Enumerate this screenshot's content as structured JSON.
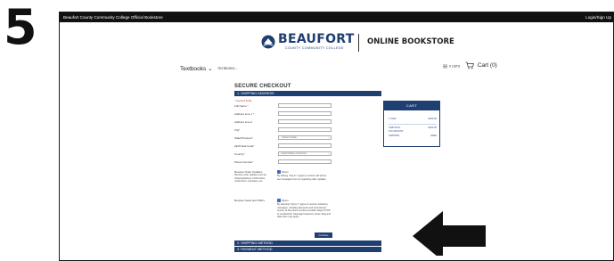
{
  "step": "5",
  "header": {
    "site_title": "Beaufort County Community College Official Bookstore",
    "login": "Login/Sign Up"
  },
  "brand": {
    "name": "BEAUFORT",
    "subtitle": "COUNTY COMMUNITY COLLEGE",
    "store": "ONLINE BOOKSTORE"
  },
  "nav": {
    "textbooks": "Textbooks",
    "textbooks_small": "TEXTBOOKS",
    "wishlist": "0 LISTS",
    "cart": "Cart (0)"
  },
  "checkout": {
    "title": "SECURE CHECKOUT",
    "section1": "1. SHIPPING ADDRESS",
    "required_note": "* required fields",
    "fields": [
      {
        "label": "Full Name *",
        "value": ""
      },
      {
        "label": "Address Line 1 *",
        "value": ""
      },
      {
        "label": "Address Line 2",
        "value": ""
      },
      {
        "label": "City*",
        "value": ""
      },
      {
        "label": "State/Province*",
        "value": "- Select a State -"
      },
      {
        "label": "Zip/Postal Code*",
        "value": ""
      },
      {
        "label": "Country*",
        "value": "United States of America"
      },
      {
        "label": "Phone Number*",
        "value": ""
      }
    ],
    "order_updates": {
      "label": "Receive Order Updates",
      "desc": "Receive order updates such as shipping/delivery confirmation, rental return reminders, etc.",
      "optin": "Opt-in",
      "text": "By clicking \"Opt-in\" I agree to receive cell phone text messages from us regarding order updates."
    },
    "news_offers": {
      "label": "Receive News and Offers",
      "optin": "Opt-in",
      "text": "By selecting \"Opt-in\" I agree to receive marketing messages, including discounts and promotional events, at the phone number provided. Reply STOP to unsubscribe. Message frequency varies. Msg and data rates may apply."
    },
    "continue": "Continue",
    "section2": "2. SHIPPING METHOD",
    "section3": "3. PAYMENT METHOD"
  },
  "cart_panel": {
    "title": "CART",
    "rows": [
      {
        "label": "1 ITEM",
        "value": "$320.00"
      },
      {
        "label": "SUBTOTAL",
        "value": "$320.00"
      },
      {
        "label": "TAX AMOUNT",
        "value": ""
      },
      {
        "label": "SHIPPING",
        "value": "FREE"
      }
    ]
  },
  "colors": {
    "brand_navy": "#1f3e72",
    "checkbox_blue": "#3a6bc7",
    "topbar": "#111111"
  }
}
